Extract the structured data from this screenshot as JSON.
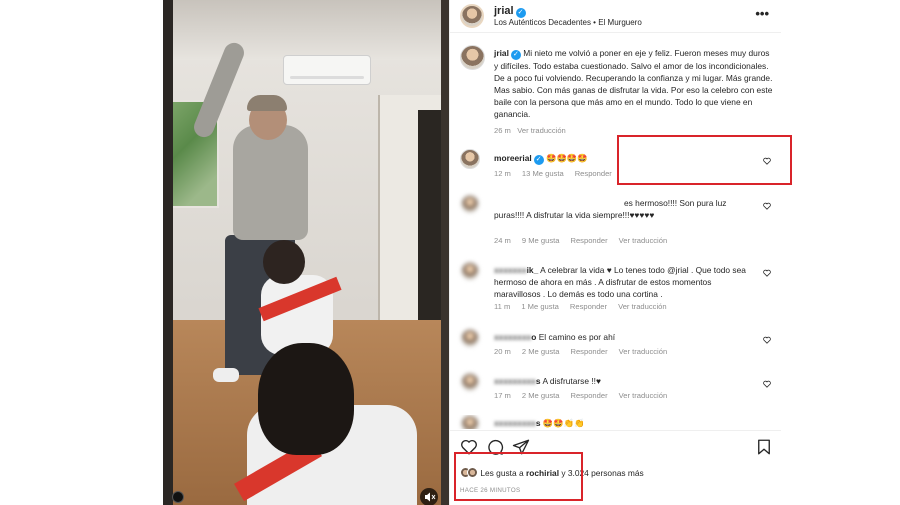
{
  "header": {
    "username": "jrial",
    "subtitle": "Los Auténticos Decadentes • El Murguero",
    "more_label": "•••"
  },
  "caption": {
    "username": "jrial",
    "text": "Mi nieto me volvió a poner en eje y feliz. Fueron meses muy duros y difíciles. Todo estaba cuestionado. Salvo el amor de los incondicionales. De a poco fui volviendo. Recuperando la confianza y mi lugar. Más grande. Mas sabio. Con más ganas de disfrutar la vida. Por eso la celebro con este baile con la persona que más amo en el mundo. Todo lo que viene en ganancia.",
    "time": "26 m",
    "translate": "Ver traducción"
  },
  "comments": [
    {
      "username": "moreerial",
      "verified": true,
      "text": "🤩🤩🤩🤩",
      "time": "12 m",
      "likes": "13 Me gusta",
      "reply": "Responder",
      "translate": ""
    },
    {
      "username": "",
      "verified": false,
      "text": "es hermoso!!!! Son pura luz puras!!!! A disfrutar la vida siempre!!!♥♥♥♥♥",
      "time": "24 m",
      "likes": "9 Me gusta",
      "reply": "Responder",
      "translate": "Ver traducción"
    },
    {
      "username": "ik_",
      "verified": false,
      "text": "A celebrar la vida ♥ Lo tenes todo @jrial . Que todo sea hermoso de ahora en más . A disfrutar de estos momentos maravillosos . Lo demás es todo una cortina .",
      "time": "11 m",
      "likes": "1 Me gusta",
      "reply": "Responder",
      "translate": "Ver traducción"
    },
    {
      "username": "o",
      "verified": false,
      "text": "El camino es por ahí",
      "time": "20 m",
      "likes": "2 Me gusta",
      "reply": "Responder",
      "translate": "Ver traducción"
    },
    {
      "username": "s",
      "verified": false,
      "text": "A disfrutarse !!♥",
      "time": "17 m",
      "likes": "2 Me gusta",
      "reply": "Responder",
      "translate": "Ver traducción"
    },
    {
      "username": "s",
      "verified": false,
      "text": "🤩🤩👏👏",
      "time": "",
      "likes": "",
      "reply": "",
      "translate": ""
    }
  ],
  "likes": {
    "prefix": "Les gusta a",
    "user": "rochirial",
    "suffix": "y 3.024 personas más"
  },
  "time_ago": "HACE 26 MINUTOS",
  "icons": {
    "heart": "heart-icon",
    "comment": "comment-icon",
    "share": "share-icon",
    "save": "bookmark-icon",
    "volume": "volume-icon"
  },
  "colors": {
    "highlight_box": "#d9242a",
    "verified": "#1d9bf0",
    "meta_text": "#8e8e8e"
  }
}
